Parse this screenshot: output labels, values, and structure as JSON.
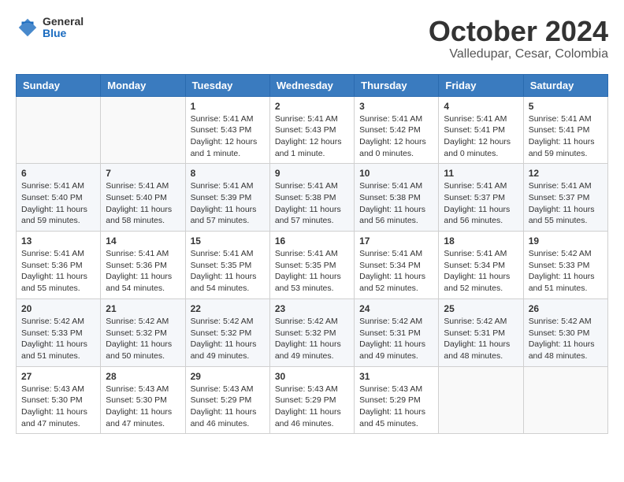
{
  "header": {
    "logo_general": "General",
    "logo_blue": "Blue",
    "month_title": "October 2024",
    "subtitle": "Valledupar, Cesar, Colombia"
  },
  "weekdays": [
    "Sunday",
    "Monday",
    "Tuesday",
    "Wednesday",
    "Thursday",
    "Friday",
    "Saturday"
  ],
  "weeks": [
    [
      {
        "day": "",
        "info": ""
      },
      {
        "day": "",
        "info": ""
      },
      {
        "day": "1",
        "info": "Sunrise: 5:41 AM\nSunset: 5:43 PM\nDaylight: 12 hours and 1 minute."
      },
      {
        "day": "2",
        "info": "Sunrise: 5:41 AM\nSunset: 5:43 PM\nDaylight: 12 hours and 1 minute."
      },
      {
        "day": "3",
        "info": "Sunrise: 5:41 AM\nSunset: 5:42 PM\nDaylight: 12 hours and 0 minutes."
      },
      {
        "day": "4",
        "info": "Sunrise: 5:41 AM\nSunset: 5:41 PM\nDaylight: 12 hours and 0 minutes."
      },
      {
        "day": "5",
        "info": "Sunrise: 5:41 AM\nSunset: 5:41 PM\nDaylight: 11 hours and 59 minutes."
      }
    ],
    [
      {
        "day": "6",
        "info": "Sunrise: 5:41 AM\nSunset: 5:40 PM\nDaylight: 11 hours and 59 minutes."
      },
      {
        "day": "7",
        "info": "Sunrise: 5:41 AM\nSunset: 5:40 PM\nDaylight: 11 hours and 58 minutes."
      },
      {
        "day": "8",
        "info": "Sunrise: 5:41 AM\nSunset: 5:39 PM\nDaylight: 11 hours and 57 minutes."
      },
      {
        "day": "9",
        "info": "Sunrise: 5:41 AM\nSunset: 5:38 PM\nDaylight: 11 hours and 57 minutes."
      },
      {
        "day": "10",
        "info": "Sunrise: 5:41 AM\nSunset: 5:38 PM\nDaylight: 11 hours and 56 minutes."
      },
      {
        "day": "11",
        "info": "Sunrise: 5:41 AM\nSunset: 5:37 PM\nDaylight: 11 hours and 56 minutes."
      },
      {
        "day": "12",
        "info": "Sunrise: 5:41 AM\nSunset: 5:37 PM\nDaylight: 11 hours and 55 minutes."
      }
    ],
    [
      {
        "day": "13",
        "info": "Sunrise: 5:41 AM\nSunset: 5:36 PM\nDaylight: 11 hours and 55 minutes."
      },
      {
        "day": "14",
        "info": "Sunrise: 5:41 AM\nSunset: 5:36 PM\nDaylight: 11 hours and 54 minutes."
      },
      {
        "day": "15",
        "info": "Sunrise: 5:41 AM\nSunset: 5:35 PM\nDaylight: 11 hours and 54 minutes."
      },
      {
        "day": "16",
        "info": "Sunrise: 5:41 AM\nSunset: 5:35 PM\nDaylight: 11 hours and 53 minutes."
      },
      {
        "day": "17",
        "info": "Sunrise: 5:41 AM\nSunset: 5:34 PM\nDaylight: 11 hours and 52 minutes."
      },
      {
        "day": "18",
        "info": "Sunrise: 5:41 AM\nSunset: 5:34 PM\nDaylight: 11 hours and 52 minutes."
      },
      {
        "day": "19",
        "info": "Sunrise: 5:42 AM\nSunset: 5:33 PM\nDaylight: 11 hours and 51 minutes."
      }
    ],
    [
      {
        "day": "20",
        "info": "Sunrise: 5:42 AM\nSunset: 5:33 PM\nDaylight: 11 hours and 51 minutes."
      },
      {
        "day": "21",
        "info": "Sunrise: 5:42 AM\nSunset: 5:32 PM\nDaylight: 11 hours and 50 minutes."
      },
      {
        "day": "22",
        "info": "Sunrise: 5:42 AM\nSunset: 5:32 PM\nDaylight: 11 hours and 49 minutes."
      },
      {
        "day": "23",
        "info": "Sunrise: 5:42 AM\nSunset: 5:32 PM\nDaylight: 11 hours and 49 minutes."
      },
      {
        "day": "24",
        "info": "Sunrise: 5:42 AM\nSunset: 5:31 PM\nDaylight: 11 hours and 49 minutes."
      },
      {
        "day": "25",
        "info": "Sunrise: 5:42 AM\nSunset: 5:31 PM\nDaylight: 11 hours and 48 minutes."
      },
      {
        "day": "26",
        "info": "Sunrise: 5:42 AM\nSunset: 5:30 PM\nDaylight: 11 hours and 48 minutes."
      }
    ],
    [
      {
        "day": "27",
        "info": "Sunrise: 5:43 AM\nSunset: 5:30 PM\nDaylight: 11 hours and 47 minutes."
      },
      {
        "day": "28",
        "info": "Sunrise: 5:43 AM\nSunset: 5:30 PM\nDaylight: 11 hours and 47 minutes."
      },
      {
        "day": "29",
        "info": "Sunrise: 5:43 AM\nSunset: 5:29 PM\nDaylight: 11 hours and 46 minutes."
      },
      {
        "day": "30",
        "info": "Sunrise: 5:43 AM\nSunset: 5:29 PM\nDaylight: 11 hours and 46 minutes."
      },
      {
        "day": "31",
        "info": "Sunrise: 5:43 AM\nSunset: 5:29 PM\nDaylight: 11 hours and 45 minutes."
      },
      {
        "day": "",
        "info": ""
      },
      {
        "day": "",
        "info": ""
      }
    ]
  ]
}
